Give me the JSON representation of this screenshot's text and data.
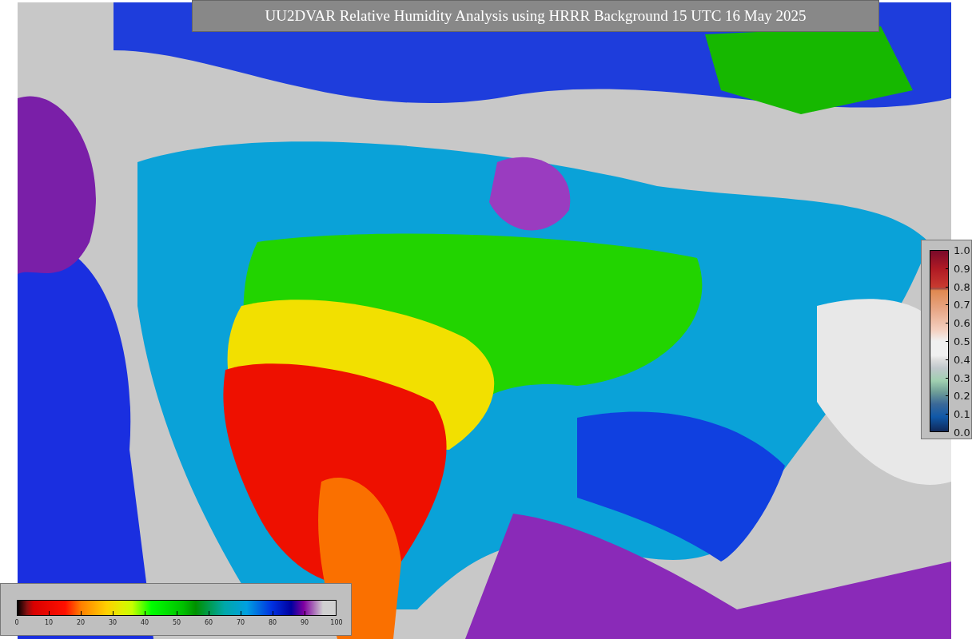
{
  "title": "UU2DVAR Relative Humidity Analysis using HRRR Background 15 UTC 16 May 2025",
  "legends": [
    {
      "kind": "horizontal",
      "ticks": [
        "0",
        "10",
        "20",
        "30",
        "40",
        "50",
        "60",
        "70",
        "80",
        "90",
        "100"
      ]
    },
    {
      "kind": "vertical",
      "ticks": [
        "1.0",
        "0.9",
        "0.8",
        "0.7",
        "0.6",
        "0.5",
        "0.4",
        "0.3",
        "0.2",
        "0.1",
        "0.0"
      ]
    }
  ]
}
